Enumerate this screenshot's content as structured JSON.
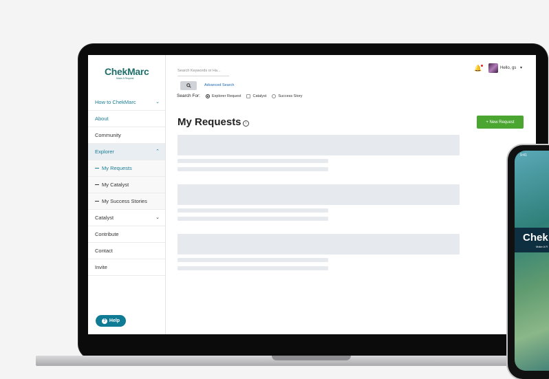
{
  "sidebar": {
    "logo_main": "ChekMarc",
    "logo_tagline": "Make A Request",
    "items": [
      {
        "label": "How to ChekMarc"
      },
      {
        "label": "About"
      },
      {
        "label": "Community"
      },
      {
        "label": "Explorer"
      },
      {
        "label": "My Requests"
      },
      {
        "label": "My Catalyst"
      },
      {
        "label": "My Success Stories"
      },
      {
        "label": "Catalyst"
      },
      {
        "label": "Contribute"
      },
      {
        "label": "Contact"
      },
      {
        "label": "Invite"
      }
    ],
    "help_label": "Help"
  },
  "header": {
    "search_placeholder": "Search Keywords or Ha...",
    "advanced_search": "Advanced Search",
    "search_for_label": "Search For:",
    "search_options": [
      "Explorer Request",
      "Catalyst",
      "Success Story"
    ],
    "selected_option": "Explorer Request",
    "greeting": "Hello, gs"
  },
  "main": {
    "title": "My Requests",
    "new_request_label": "+ New Request"
  },
  "phone": {
    "time": "9:41",
    "logo": "Chek",
    "tagline": "Make A R"
  },
  "colors": {
    "brand_teal": "#1a7d95",
    "new_button_green": "#4aa531",
    "skeleton": "#e6e9ed"
  },
  "icons": [
    "chevron-down-icon",
    "chevron-up-icon",
    "search-icon",
    "bell-icon",
    "info-icon",
    "help-icon"
  ]
}
